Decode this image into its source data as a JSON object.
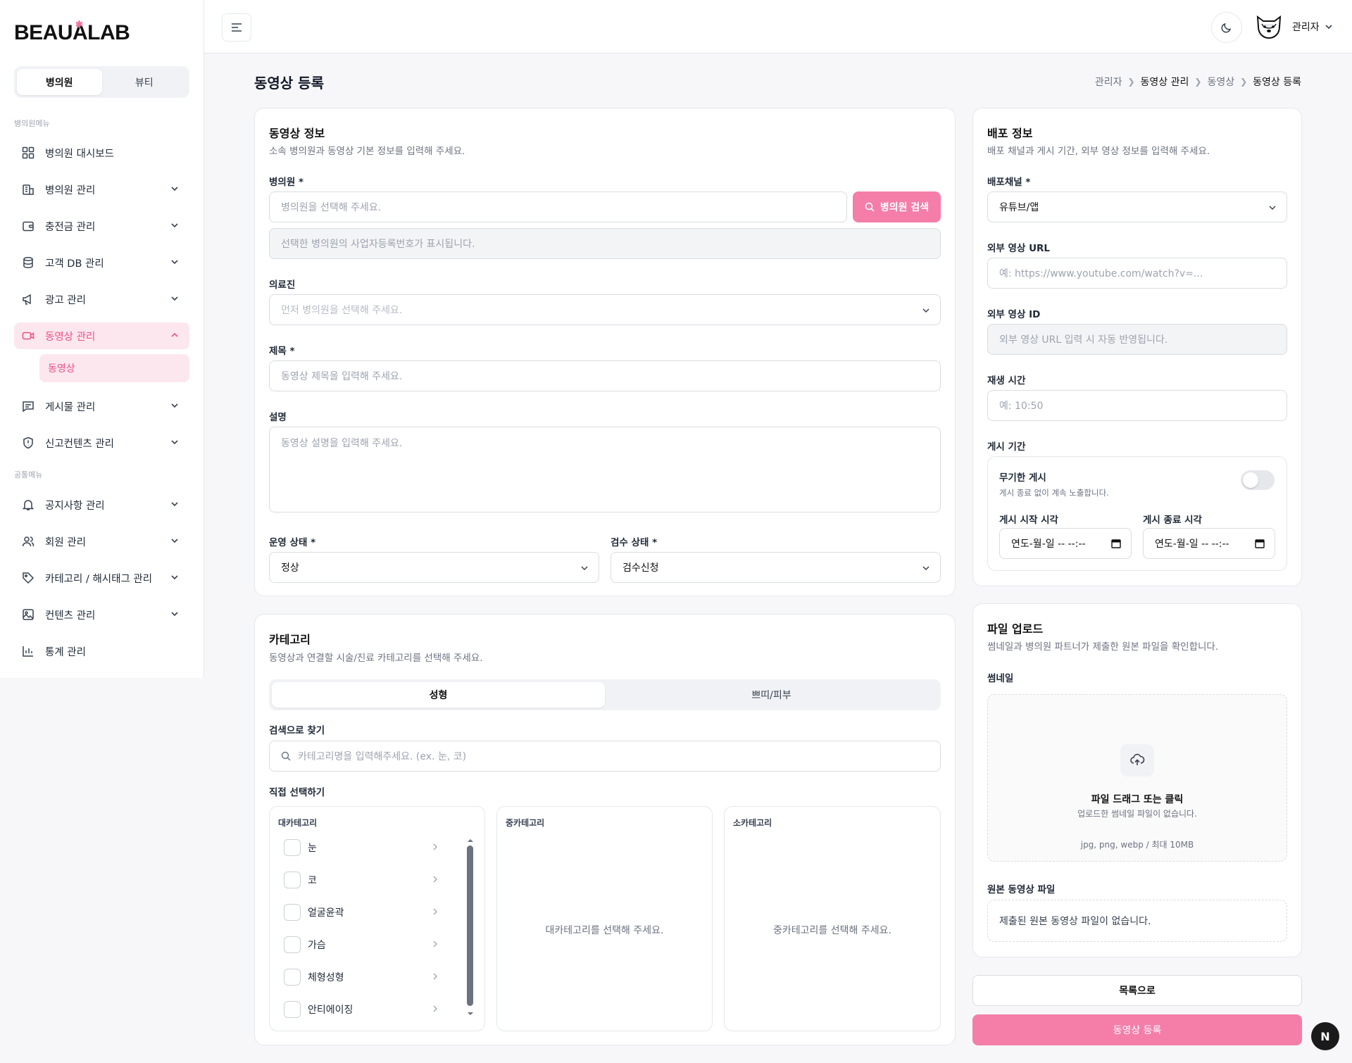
{
  "brand": {
    "logo": "BEAUALAB",
    "star": "✱"
  },
  "sidebar": {
    "segment": [
      "병의원",
      "뷰티"
    ],
    "section1": "병의원메뉴",
    "items": [
      "병의원 대시보드",
      "병의원 관리",
      "충전금 관리",
      "고객 DB 관리",
      "광고 관리",
      "동영상 관리",
      "게시물 관리",
      "신고컨텐츠 관리"
    ],
    "sub_item": "동영상",
    "section2": "공통메뉴",
    "items2": [
      "공지사항 관리",
      "회원 관리",
      "카테고리 / 해시태그 관리",
      "컨텐츠 관리",
      "통계 관리"
    ]
  },
  "topbar": {
    "user": "관리자"
  },
  "page": {
    "title": "동영상 등록",
    "breadcrumb": [
      "관리자",
      "동영상 관리",
      "동영상",
      "동영상 등록"
    ]
  },
  "info": {
    "title": "동영상 정보",
    "subtitle": "소속 병의원과 동영상 기본 정보를 입력해 주세요.",
    "hospital_label": "병의원 *",
    "hospital_placeholder": "병의원을 선택해 주세요.",
    "search_button": "병의원 검색",
    "bizno_placeholder": "선택한 병의원의 사업자등록번호가 표시됩니다.",
    "doctor_label": "의료진",
    "doctor_placeholder": "먼저 병의원을 선택해 주세요.",
    "title_label": "제목 *",
    "title_placeholder": "동영상 제목을 입력해 주세요.",
    "desc_label": "설명",
    "desc_placeholder": "동영상 설명을 입력해 주세요.",
    "status_label": "운영 상태 *",
    "status_value": "정상",
    "review_label": "검수 상태 *",
    "review_value": "검수신청"
  },
  "category": {
    "title": "카테고리",
    "subtitle": "동영상과 연결할 시술/진료 카테고리를 선택해 주세요.",
    "tabs": [
      "성형",
      "쁘띠/피부"
    ],
    "search_label": "검색으로 찾기",
    "search_placeholder": "카테고리명을 입력해주세요. (ex. 눈, 코)",
    "direct_label": "직접 선택하기",
    "col1": "대카테고리",
    "col2": "중카테고리",
    "col3": "소카테고리",
    "items": [
      "눈",
      "코",
      "얼굴윤곽",
      "가슴",
      "체형성형",
      "안티에이징"
    ],
    "col2_empty": "대카테고리를 선택해 주세요.",
    "col3_empty": "중카테고리를 선택해 주세요."
  },
  "deploy": {
    "title": "배포 정보",
    "subtitle": "배포 채널과 게시 기간, 외부 영상 정보를 입력해 주세요.",
    "channel_label": "배포채널 *",
    "channel_value": "유튜브/앱",
    "url_label": "외부 영상 URL",
    "url_placeholder": "예: https://www.youtube.com/watch?v=...",
    "id_label": "외부 영상 ID",
    "id_placeholder": "외부 영상 URL 입력 시 자동 반영됩니다.",
    "time_label": "재생 시간",
    "time_placeholder": "예: 10:50",
    "period_label": "게시 기간",
    "unlimited_title": "무기한 게시",
    "unlimited_desc": "게시 종료 없이 계속 노출합니다.",
    "unlimited_on": false,
    "start_label": "게시 시작 시각",
    "end_label": "게시 종료 시각",
    "start_value": "연도-월-일 -- --:--",
    "end_value": "연도-월-일 -- --:--"
  },
  "upload": {
    "title": "파일 업로드",
    "subtitle": "썸네일과 병의원 파트너가 제출한 원본 파일을 확인합니다.",
    "thumb_label": "썸네일",
    "drop_title": "파일 드래그 또는 클릭",
    "drop_desc": "업로드한 썸네일 파일이 없습니다.",
    "drop_hint": "jpg, png, webp / 최대 10MB",
    "original_label": "원본 동영상 파일",
    "original_empty": "제출된 원본 동영상 파일이 없습니다."
  },
  "actions": {
    "list": "목록으로",
    "submit": "동영상 등록"
  },
  "fab": "N",
  "colors": {
    "accent": "#f47ea8",
    "accent_soft": "#fde7ef",
    "accent_text": "#ec4f86"
  }
}
